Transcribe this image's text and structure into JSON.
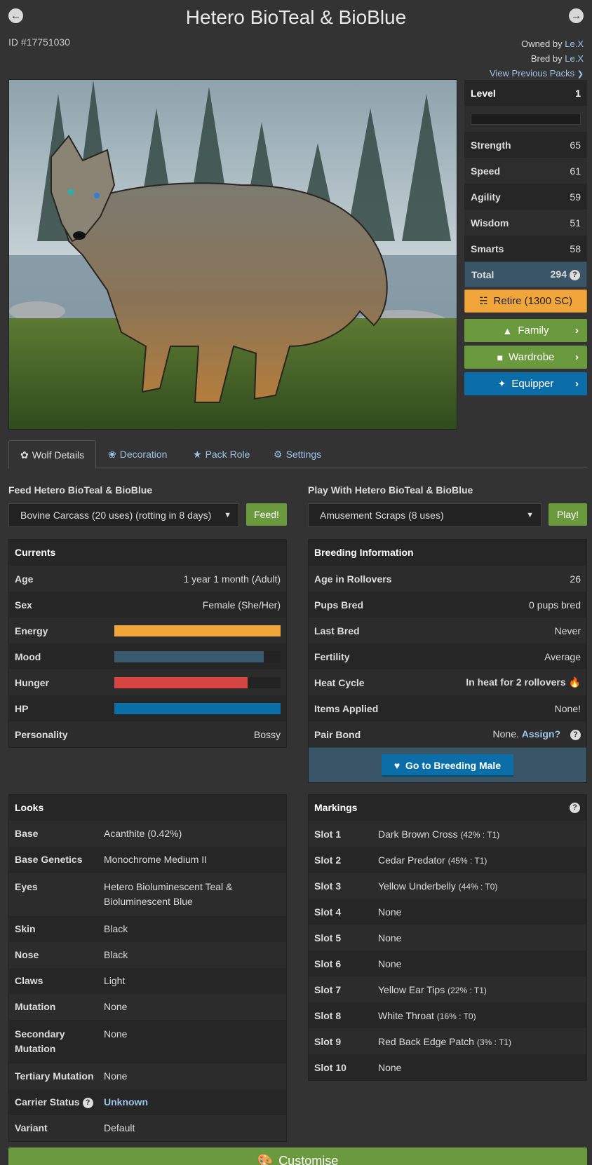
{
  "header": {
    "title": "Hetero BioTeal & BioBlue",
    "prev_icon": "arrow-left",
    "next_icon": "arrow-right",
    "id_label": "ID #17751030",
    "owned_by_label": "Owned by",
    "owner_name": "Le.X",
    "bred_by_label": "Bred by",
    "breeder_name": "Le.X",
    "previous_packs": "View Previous Packs"
  },
  "stats": {
    "level_label": "Level",
    "level": "1",
    "xp_progress": 0,
    "rows": [
      {
        "label": "Strength",
        "value": "65"
      },
      {
        "label": "Speed",
        "value": "61"
      },
      {
        "label": "Agility",
        "value": "59"
      },
      {
        "label": "Wisdom",
        "value": "51"
      },
      {
        "label": "Smarts",
        "value": "58"
      }
    ],
    "total_label": "Total",
    "total": "294"
  },
  "actions": {
    "retire": "Retire (1300 SC)",
    "family": "Family",
    "wardrobe": "Wardrobe",
    "equipper": "Equipper"
  },
  "tabs": [
    {
      "label": "Wolf Details",
      "icon": "paw-icon"
    },
    {
      "label": "Decoration",
      "icon": "leaf-icon"
    },
    {
      "label": "Pack Role",
      "icon": "star-icon"
    },
    {
      "label": "Settings",
      "icon": "gear-icon"
    }
  ],
  "feed": {
    "label": "Feed Hetero BioTeal & BioBlue",
    "selected": "Bovine Carcass (20 uses) (rotting in 8 days)",
    "button": "Feed!"
  },
  "play": {
    "label": "Play With Hetero BioTeal & BioBlue",
    "selected": "Amusement Scraps (8 uses)",
    "button": "Play!"
  },
  "currents": {
    "title": "Currents",
    "age_label": "Age",
    "age": "1 year 1 month (Adult)",
    "sex_label": "Sex",
    "sex": "Female (She/Her)",
    "energy_label": "Energy",
    "energy": 100,
    "mood_label": "Mood",
    "mood": 90,
    "hunger_label": "Hunger",
    "hunger": 80,
    "hp_label": "HP",
    "hp": 100,
    "personality_label": "Personality",
    "personality": "Bossy",
    "colors": {
      "energy": "#f0a63a",
      "mood": "#3a5a70",
      "hunger": "#d64541",
      "hp": "#0b6ea8"
    }
  },
  "breeding": {
    "title": "Breeding Information",
    "rows": [
      {
        "label": "Age in Rollovers",
        "value": "26"
      },
      {
        "label": "Pups Bred",
        "value": "0 pups bred"
      },
      {
        "label": "Last Bred",
        "value": "Never"
      },
      {
        "label": "Fertility",
        "value": "Average"
      }
    ],
    "heat_label": "Heat Cycle",
    "heat": "In heat for 2 rollovers",
    "items_label": "Items Applied",
    "items": "None!",
    "pair_label": "Pair Bond",
    "pair": "None.",
    "assign": "Assign?",
    "button": "Go to Breeding Male"
  },
  "looks": {
    "title": "Looks",
    "rows": [
      {
        "label": "Base",
        "value": "Acanthite (0.42%)"
      },
      {
        "label": "Base Genetics",
        "value": "Monochrome Medium II"
      },
      {
        "label": "Eyes",
        "value": "Hetero Bioluminescent Teal & Bioluminescent Blue"
      },
      {
        "label": "Skin",
        "value": "Black"
      },
      {
        "label": "Nose",
        "value": "Black"
      },
      {
        "label": "Claws",
        "value": "Light"
      },
      {
        "label": "Mutation",
        "value": "None"
      },
      {
        "label": "Secondary Mutation",
        "value": "None"
      },
      {
        "label": "Tertiary Mutation",
        "value": "None"
      }
    ],
    "carrier_label": "Carrier Status",
    "carrier": "Unknown",
    "variant_label": "Variant",
    "variant": "Default"
  },
  "markings": {
    "title": "Markings",
    "rows": [
      {
        "label": "Slot 1",
        "value": "Dark Brown Cross",
        "pct": "(42% : T1)"
      },
      {
        "label": "Slot 2",
        "value": "Cedar Predator",
        "pct": "(45% : T1)"
      },
      {
        "label": "Slot 3",
        "value": "Yellow Underbelly",
        "pct": "(44% : T0)"
      },
      {
        "label": "Slot 4",
        "value": "None",
        "pct": ""
      },
      {
        "label": "Slot 5",
        "value": "None",
        "pct": ""
      },
      {
        "label": "Slot 6",
        "value": "None",
        "pct": ""
      },
      {
        "label": "Slot 7",
        "value": "Yellow Ear Tips",
        "pct": "(22% : T1)"
      },
      {
        "label": "Slot 8",
        "value": "White Throat",
        "pct": "(16% : T0)"
      },
      {
        "label": "Slot 9",
        "value": "Red Back Edge Patch",
        "pct": "(3% : T1)"
      },
      {
        "label": "Slot 10",
        "value": "None",
        "pct": ""
      }
    ]
  },
  "customise": "Customise"
}
